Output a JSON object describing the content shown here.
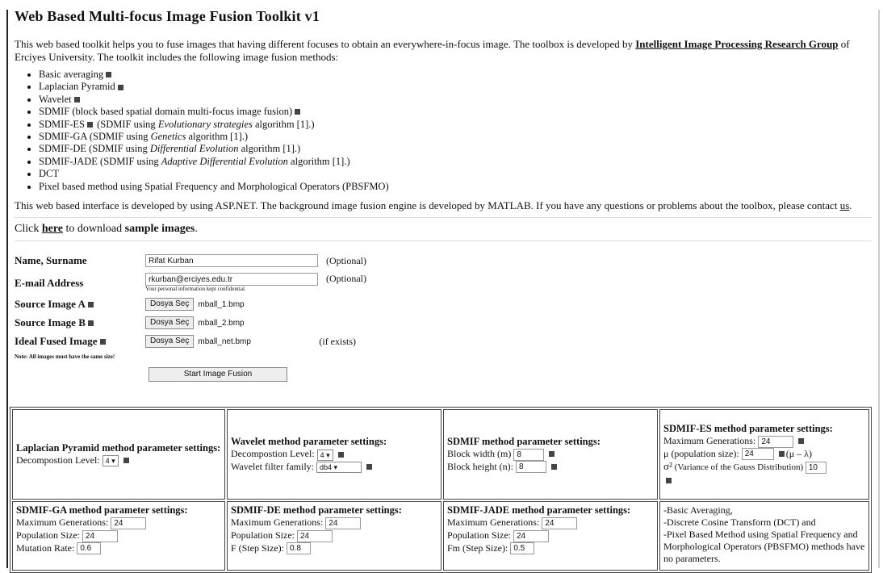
{
  "title": "Web Based Multi-focus Image Fusion Toolkit v1",
  "intro": {
    "text1": "This web based toolkit helps you to fuse images that having different focuses to obtain an everywhere-in-focus image. The toolbox is developed by ",
    "link": "Intelligent Image Processing Research Group",
    "text2": " of Erciyes University. The toolkit includes the following image fusion methods:"
  },
  "methods": [
    {
      "a": "Basic averaging",
      "b": "",
      "c": "",
      "help": true
    },
    {
      "a": "Laplacian Pyramid",
      "b": "",
      "c": "",
      "help": true
    },
    {
      "a": "Wavelet",
      "b": "",
      "c": "",
      "help": true
    },
    {
      "a": "SDMIF (block based spatial domain multi-focus image fusion)",
      "b": "",
      "c": "",
      "help": true
    },
    {
      "a": "SDMIF-ES",
      "help_mid": true,
      "b": " (SDMIF using ",
      "i": "Evolutionary strategies",
      "c": " algorithm [1].)"
    },
    {
      "a": "SDMIF-GA (SDMIF using ",
      "i": "Genetics",
      "c": " algorithm [1].)"
    },
    {
      "a": "SDMIF-DE (SDMIF using ",
      "i": "Differential Evolution",
      "c": " algorithm [1].)"
    },
    {
      "a": "SDMIF-JADE (SDMIF using ",
      "i": "Adaptive Differential Evolution",
      "c": " algorithm [1].)"
    },
    {
      "a": "DCT"
    },
    {
      "a": "Pixel based method using Spatial Frequency and Morphological Operators (PBSFMO)"
    }
  ],
  "contact": {
    "text": "This web based interface is developed by using ASP.NET. The background image fusion engine is developed by MATLAB. If you have any questions or problems about the toolbox, please contact ",
    "link": "us",
    "end": "."
  },
  "sample": {
    "pre": "Click ",
    "link": "here",
    "post": " to download ",
    "bold": "sample images",
    "end": "."
  },
  "form": {
    "name_label": "Name, Surname",
    "name_value": "Rifat Kurban",
    "optional": "(Optional)",
    "email_label": "E-mail Address",
    "email_value": "rkurban@erciyes.edu.tr",
    "privacy": "Your personal information kept confidential.",
    "srcA_label": "Source Image A",
    "srcB_label": "Source Image B",
    "ideal_label": "Ideal Fused Image",
    "file_button": "Dosya Seç",
    "fileA": "mball_1.bmp",
    "fileB": "mball_2.bmp",
    "fileIdeal": "mball_net.bmp",
    "if_exists": "(if exists)",
    "note": "Note: All images must have the same size!",
    "start_button": "Start Image Fusion"
  },
  "params": {
    "lap_title": "Laplacian Pyramid method parameter settings:",
    "lap_level_label": "Decompostion Level:",
    "lap_level": "4",
    "wav_title": "Wavelet method parameter settings:",
    "wav_level_label": "Decompostion Level:",
    "wav_level": "4",
    "wav_filter_label": "Wavelet filter family:",
    "wav_filter": "db4",
    "sdmif_title": "SDMIF method parameter settings:",
    "sdmif_w_label": "Block width (m)",
    "sdmif_w": "8",
    "sdmif_h_label": "Block height (n):",
    "sdmif_h": "8",
    "es_title": "SDMIF-ES method parameter settings:",
    "es_maxgen_label": "Maximum Generations:",
    "es_maxgen": "24",
    "es_pop_label": "(population size):",
    "es_pop": "24",
    "es_mu": "μ",
    "es_ratio": "(μ – λ)",
    "es_sigma": "σ²",
    "es_var_label": "(Variance of the Gauss Distribution)",
    "es_var": "10",
    "ga_title": "SDMIF-GA method parameter settings:",
    "ga_maxgen_label": "Maximum Generations:",
    "ga_maxgen": "24",
    "ga_pop_label": "Population Size:",
    "ga_pop": "24",
    "ga_mut_label": "Mutation Rate:",
    "ga_mut": "0.6",
    "de_title": "SDMIF-DE method parameter settings:",
    "de_maxgen_label": "Maximum Generations:",
    "de_maxgen": "24",
    "de_pop_label": "Population Size:",
    "de_pop": "24",
    "de_f_label": "F (Step Size):",
    "de_f": "0.8",
    "jade_title": "SDMIF-JADE method parameter settings:",
    "jade_maxgen_label": "Maximum Generations:",
    "jade_maxgen": "24",
    "jade_pop_label": "Population Size:",
    "jade_pop": "24",
    "jade_fm_label": "Fm (Step Size):",
    "jade_fm": "0.5",
    "noparam_1": "-Basic Averaging,",
    "noparam_2": "-Discrete Cosine Transform (DCT) and",
    "noparam_3": "-Pixel Based Method using Spatial Frequency and Morphological Operators (PBSFMO) methods have no parameters."
  }
}
